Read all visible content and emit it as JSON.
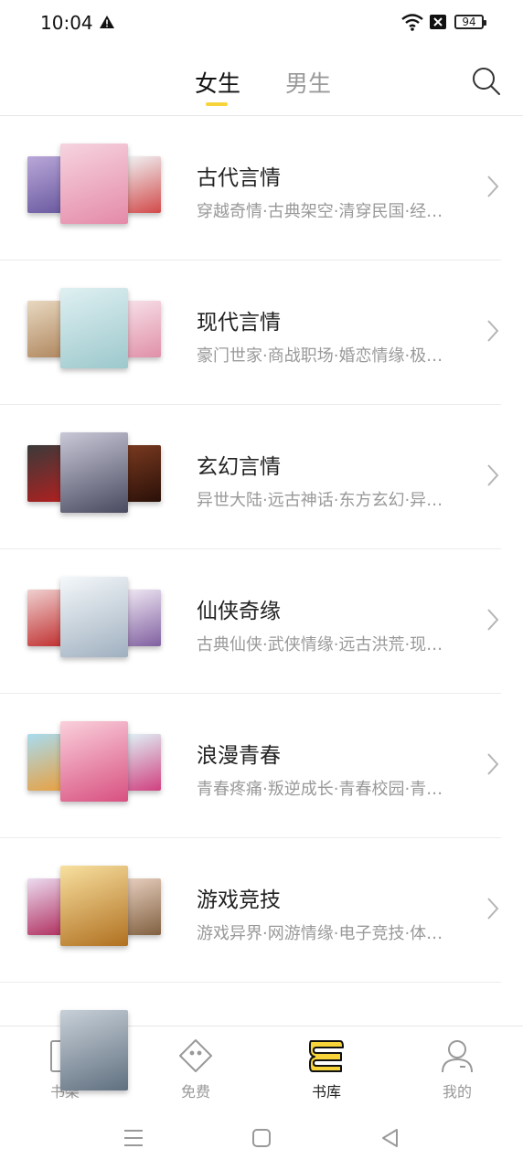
{
  "status_bar": {
    "time": "10:04",
    "battery": "94"
  },
  "tabs": [
    {
      "label": "女生",
      "active": true
    },
    {
      "label": "男生",
      "active": false
    }
  ],
  "categories": [
    {
      "title": "古代言情",
      "tags": "穿越奇情·古典架空·清穿民国·经…",
      "covers": [
        "#b9a7d8",
        "#f4c9d8",
        "#e8eef0"
      ]
    },
    {
      "title": "现代言情",
      "tags": "豪门世家·商战职场·婚恋情缘·极…",
      "covers": [
        "#d9c2a8",
        "#cfe6e8",
        "#f3d2dc"
      ]
    },
    {
      "title": "玄幻言情",
      "tags": "异世大陆·远古神话·东方玄幻·异…",
      "covers": [
        "#2a2a2a",
        "#8a8aa0",
        "#5a2a20"
      ]
    },
    {
      "title": "仙侠奇缘",
      "tags": "古典仙侠·武侠情缘·远古洪荒·现…",
      "covers": [
        "#c83c3c",
        "#e4ecf2",
        "#e8e0f0"
      ]
    },
    {
      "title": "浪漫青春",
      "tags": "青春疼痛·叛逆成长·青春校园·青…",
      "covers": [
        "#6fb8e0",
        "#f5b6c8",
        "#c8e8f0"
      ]
    },
    {
      "title": "游戏竞技",
      "tags": "游戏异界·网游情缘·电子竞技·体…",
      "covers": [
        "#d8c8e0",
        "#e6a848",
        "#c0a070"
      ]
    }
  ],
  "bottom_nav": [
    {
      "label": "书架",
      "icon": "bookshelf-icon",
      "active": false
    },
    {
      "label": "免费",
      "icon": "free-tag-icon",
      "active": false
    },
    {
      "label": "书库",
      "icon": "library-icon",
      "active": true
    },
    {
      "label": "我的",
      "icon": "profile-icon",
      "active": false
    }
  ],
  "colors": {
    "accent": "#f7d53a",
    "text_primary": "#222222",
    "text_secondary": "#999999"
  }
}
